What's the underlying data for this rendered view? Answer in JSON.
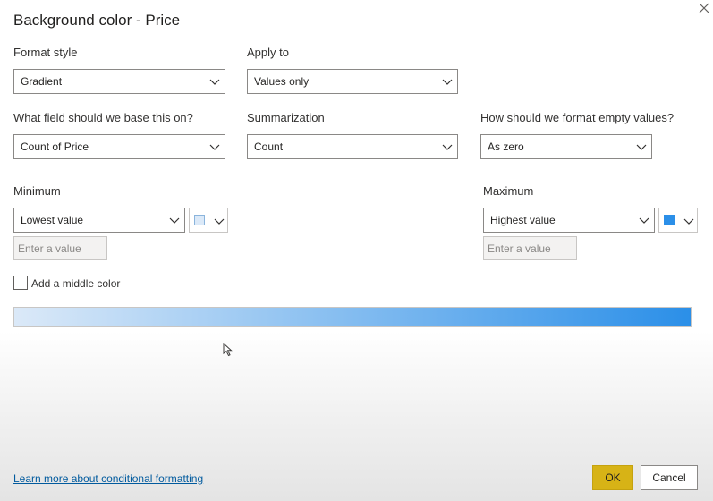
{
  "dialog": {
    "title": "Background color - Price"
  },
  "format_style": {
    "label": "Format style",
    "value": "Gradient"
  },
  "apply_to": {
    "label": "Apply to",
    "value": "Values only"
  },
  "base_field": {
    "label": "What field should we base this on?",
    "value": "Count of Price"
  },
  "summarization": {
    "label": "Summarization",
    "value": "Count"
  },
  "empty_values": {
    "label": "How should we format empty values?",
    "value": "As zero"
  },
  "minimum": {
    "label": "Minimum",
    "value": "Lowest value",
    "input_placeholder": "Enter a value",
    "color": "#dbe9f8"
  },
  "maximum": {
    "label": "Maximum",
    "value": "Highest value",
    "input_placeholder": "Enter a value",
    "color": "#2b8fe8"
  },
  "middle_color": {
    "label": "Add a middle color",
    "checked": false
  },
  "footer": {
    "learn_more": "Learn more about conditional formatting",
    "ok_label": "OK",
    "cancel_label": "Cancel"
  },
  "icons": [
    "close-icon",
    "chevron-down-icon",
    "mouse-pointer-icon"
  ]
}
